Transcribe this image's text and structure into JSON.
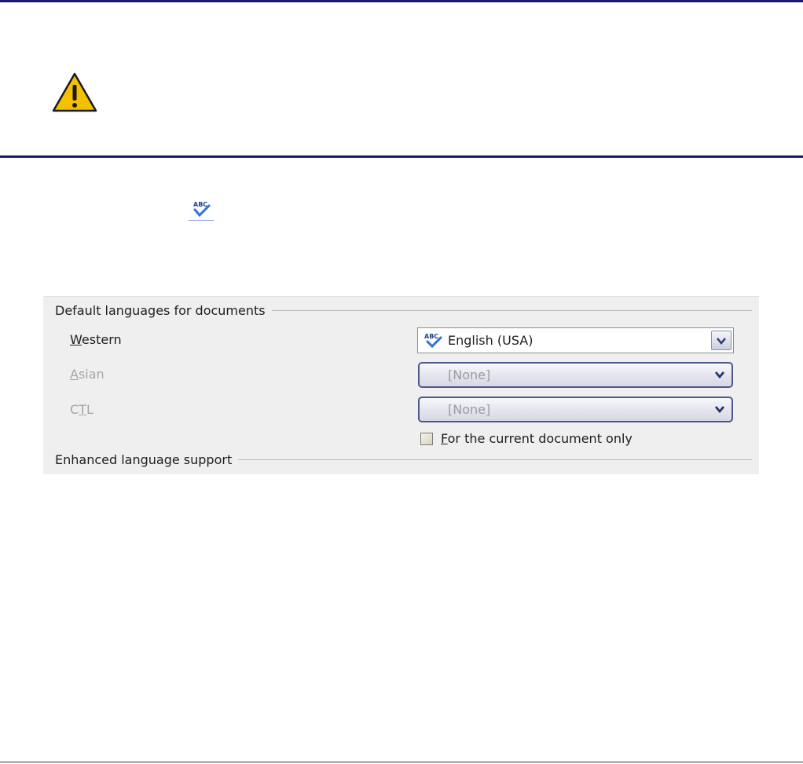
{
  "icons": {
    "warning": "warning-icon",
    "spelling": "spelling-check-icon",
    "dropdown": "chevron-down-icon"
  },
  "colors": {
    "rule": "#1a1a6e",
    "panel_bg": "#efefef",
    "disabled_text": "#a6a6a6",
    "combo_border": "#4b5a86"
  },
  "default_languages": {
    "heading": "Default languages for documents",
    "western": {
      "label_key": "W",
      "label_rest": "estern",
      "value": "English (USA)"
    },
    "asian": {
      "label_key": "A",
      "label_rest": "sian",
      "value": "[None]"
    },
    "ctl": {
      "label_pre": "C",
      "label_key": "T",
      "label_rest": "L",
      "value": "[None]"
    },
    "current_doc_only": {
      "label_key": "F",
      "label_rest": "or the current document only",
      "checked": false
    }
  },
  "enhanced": {
    "heading": "Enhanced language support"
  }
}
